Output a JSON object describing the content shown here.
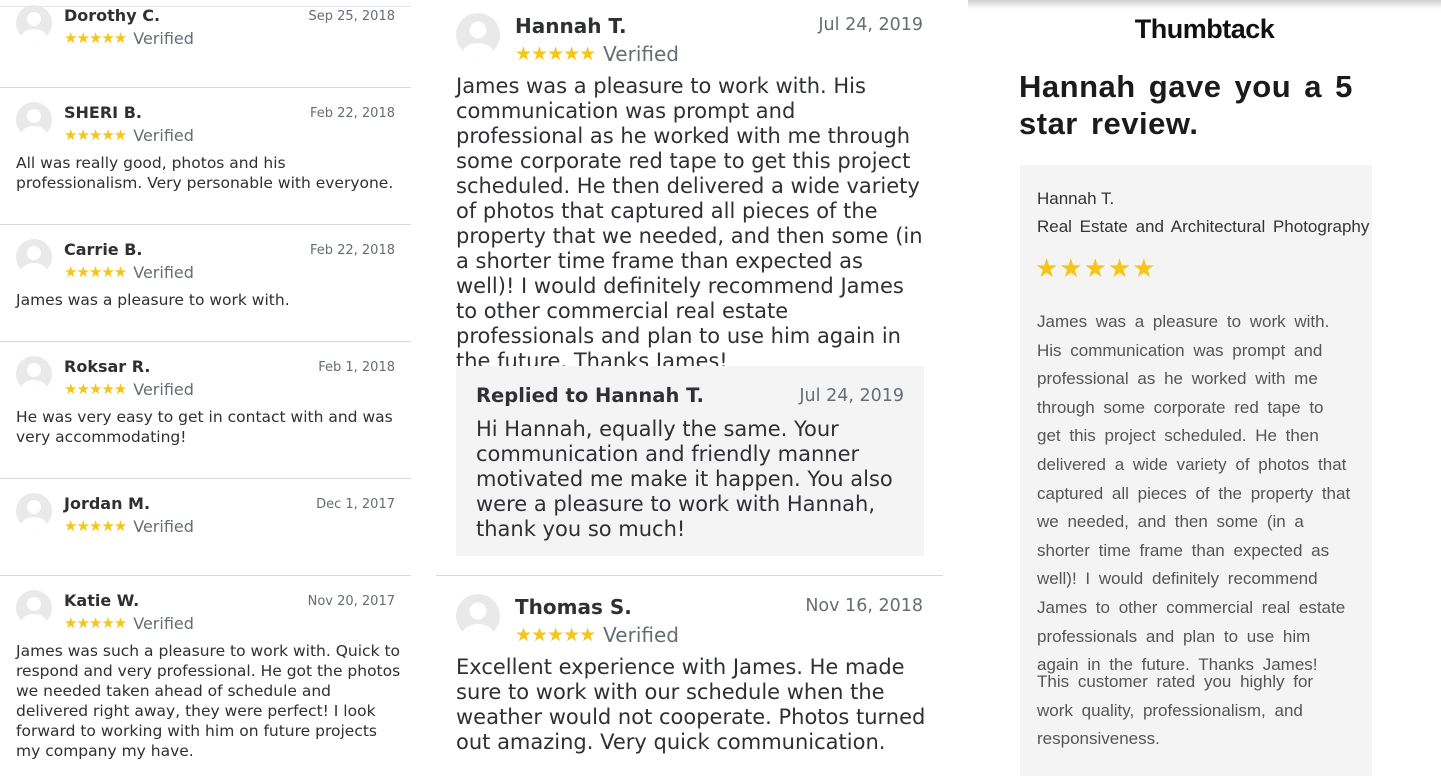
{
  "left_reviews": [
    {
      "name": "Dorothy C.",
      "date": "Sep 25, 2018",
      "stars": "★★★★★",
      "verified": "Verified",
      "text": ""
    },
    {
      "name": "SHERI B.",
      "date": "Feb 22, 2018",
      "stars": "★★★★★",
      "verified": "Verified",
      "text": "All was really good, photos and his professionalism.  Very personable with everyone."
    },
    {
      "name": "Carrie B.",
      "date": "Feb 22, 2018",
      "stars": "★★★★★",
      "verified": "Verified",
      "text": "James was a pleasure to work with."
    },
    {
      "name": "Roksar R.",
      "date": "Feb 1, 2018",
      "stars": "★★★★★",
      "verified": "Verified",
      "text": "He was very easy to get in contact with and was very accommodating!"
    },
    {
      "name": "Jordan M.",
      "date": "Dec 1, 2017",
      "stars": "★★★★★",
      "verified": "Verified",
      "text": ""
    },
    {
      "name": "Katie W.",
      "date": "Nov 20, 2017",
      "stars": "★★★★★",
      "verified": "Verified",
      "text": "James was such a pleasure to work with. Quick to respond and very professional. He got the photos we needed taken ahead of schedule and delivered right away, they were perfect! I look forward to working with him on future projects my company my have."
    }
  ],
  "main_review": {
    "name": "Hannah T.",
    "date": "Jul 24, 2019",
    "stars": "★★★★★",
    "verified": "Verified",
    "text": "James was a pleasure to work with. His communication was prompt and professional as he worked with me through some corporate red tape to get this project scheduled. He then delivered a wide variety of photos that captured all pieces of the property that we needed, and then some (in a shorter time frame than expected as well)! I would definitely recommend James to other commercial real estate professionals and plan to use him again in the future. Thanks James!",
    "reply": {
      "title": "Replied to Hannah T.",
      "date": "Jul 24, 2019",
      "text": "Hi Hannah, equally the same.  Your communication and friendly manner motivated me make it happen. You also were a pleasure to work with Hannah, thank you so much!"
    }
  },
  "second_review": {
    "name": "Thomas S.",
    "date": "Nov 16, 2018",
    "stars": "★★★★★",
    "verified": "Verified",
    "text": "Excellent experience with James. He made sure to work with our schedule when the weather would not cooperate. Photos turned out amazing. Very quick communication."
  },
  "email": {
    "brand": "Thumbtack",
    "headline": "Hannah gave you a 5 star review.",
    "card": {
      "name": "Hannah T.",
      "service": "Real Estate and Architectural Photography",
      "stars": "★★★★★",
      "review": "James was a pleasure to work with. His communication was prompt and professional as he worked with me through some corporate red tape to get this project scheduled. He then delivered a wide variety of photos that captured all pieces of the property that we needed, and then some (in a shorter time frame than expected as well)! I would definitely recommend James to other commercial real estate professionals and plan to use him again in the future. Thanks James!",
      "footer": "This customer rated you highly for work quality, professionalism, and responsiveness."
    }
  },
  "colors": {
    "star": "#f5c518",
    "text": "#2f3033",
    "muted": "#676d73",
    "panel": "#f4f4f4"
  },
  "icons": {
    "avatar": "avatar-placeholder-icon",
    "star": "star-icon"
  }
}
